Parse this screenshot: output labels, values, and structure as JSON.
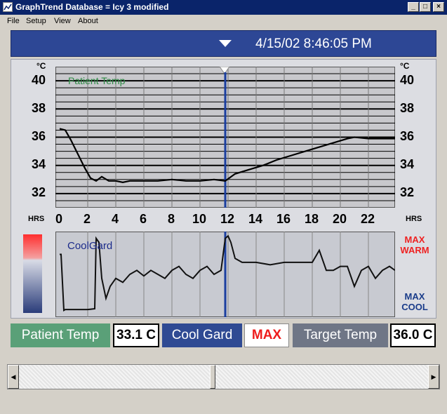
{
  "window": {
    "title": "GraphTrend  Database = Icy 3 modified",
    "controls": {
      "minimize": "_",
      "maximize": "□",
      "close": "×"
    }
  },
  "menu": {
    "items": [
      "File",
      "Setup",
      "View",
      "About"
    ]
  },
  "header": {
    "datetime": "4/15/02 8:46:05 PM"
  },
  "colors": {
    "header_bg": "#2d4795",
    "patient_temp_green": "#5aa078",
    "cool_gard_blue": "#2f4a93",
    "target_temp_gray": "#6f7686",
    "cursor_blue": "#1b3fa0",
    "max_warm_red": "#ee2222",
    "max_cool_blue": "#1a3c8a"
  },
  "temp_chart": {
    "series_label": "Patient Temp",
    "unit_left": "°C",
    "unit_right": "°C",
    "y_ticks": [
      "40",
      "38",
      "36",
      "34",
      "32"
    ],
    "x_unit_left": "HRS",
    "x_unit_right": "HRS",
    "x_ticks": [
      "0",
      "2",
      "4",
      "6",
      "8",
      "10",
      "12",
      "14",
      "16",
      "18",
      "20",
      "22"
    ]
  },
  "coolgard_chart": {
    "series_label": "CoolGard",
    "max_warm_line1": "MAX",
    "max_warm_line2": "WARM",
    "max_cool_line1": "MAX",
    "max_cool_line2": "COOL"
  },
  "status": {
    "patient_temp_label": "Patient Temp",
    "patient_temp_value": "33.1 C",
    "cool_gard_label": "Cool Gard",
    "cool_gard_value": "MAX",
    "target_temp_label": "Target Temp",
    "target_temp_value": "36.0 C"
  },
  "chart_data": [
    {
      "type": "line",
      "title": "Patient Temp",
      "xlabel": "HRS",
      "ylabel": "°C",
      "xlim": [
        0,
        24
      ],
      "ylim": [
        31,
        41
      ],
      "x_ticks": [
        0,
        2,
        4,
        6,
        8,
        10,
        12,
        14,
        16,
        18,
        20,
        22
      ],
      "y_ticks": [
        32,
        34,
        36,
        38,
        40
      ],
      "cursor_x": 11.8,
      "series": [
        {
          "name": "Patient Temp",
          "x": [
            0,
            0.4,
            0.8,
            1.3,
            1.8,
            2.2,
            2.6,
            3.0,
            3.5,
            4.0,
            4.5,
            5.0,
            5.5,
            6.0,
            7.0,
            8.0,
            9.0,
            10.0,
            11.0,
            11.8,
            12.5,
            13.5,
            14.5,
            15.5,
            16.5,
            17.5,
            18.5,
            19.5,
            20.5,
            21.0,
            22.0,
            23.0,
            23.9
          ],
          "y": [
            36.6,
            36.5,
            35.8,
            34.8,
            33.8,
            33.1,
            32.9,
            33.2,
            32.9,
            32.9,
            32.8,
            32.9,
            32.9,
            32.9,
            32.9,
            33.0,
            32.9,
            32.9,
            33.0,
            32.9,
            33.4,
            33.7,
            34.0,
            34.4,
            34.7,
            35.0,
            35.3,
            35.6,
            35.9,
            36.0,
            35.9,
            35.9,
            35.9
          ]
        }
      ]
    },
    {
      "type": "line",
      "title": "CoolGard",
      "xlim": [
        0,
        24
      ],
      "ylim": [
        0,
        1
      ],
      "x_ticks": [
        0,
        2,
        4,
        6,
        8,
        10,
        12,
        14,
        16,
        18,
        20,
        22
      ],
      "cursor_x": 11.8,
      "series": [
        {
          "name": "CoolGard",
          "x": [
            0,
            0.1,
            0.3,
            0.4,
            1.0,
            2.0,
            2.5,
            2.6,
            2.8,
            3.0,
            3.3,
            3.6,
            4.0,
            4.5,
            5.0,
            5.5,
            6.0,
            6.5,
            7.0,
            7.5,
            8.0,
            8.5,
            9.0,
            9.5,
            10.0,
            10.5,
            11.0,
            11.5,
            11.8,
            12.0,
            12.2,
            12.5,
            13.0,
            14.0,
            15.0,
            16.0,
            17.0,
            18.0,
            18.5,
            19.0,
            19.5,
            20.0,
            20.5,
            21.0,
            21.5,
            22.0,
            22.5,
            23.0,
            23.5,
            23.9
          ],
          "y": [
            0.75,
            0.75,
            0.05,
            0.06,
            0.06,
            0.06,
            0.07,
            0.95,
            0.9,
            0.45,
            0.2,
            0.35,
            0.45,
            0.4,
            0.5,
            0.55,
            0.48,
            0.55,
            0.5,
            0.45,
            0.55,
            0.6,
            0.5,
            0.45,
            0.55,
            0.6,
            0.5,
            0.55,
            0.95,
            0.98,
            0.9,
            0.7,
            0.65,
            0.65,
            0.62,
            0.65,
            0.65,
            0.65,
            0.8,
            0.55,
            0.55,
            0.6,
            0.6,
            0.35,
            0.55,
            0.6,
            0.45,
            0.55,
            0.6,
            0.55
          ]
        }
      ]
    }
  ]
}
